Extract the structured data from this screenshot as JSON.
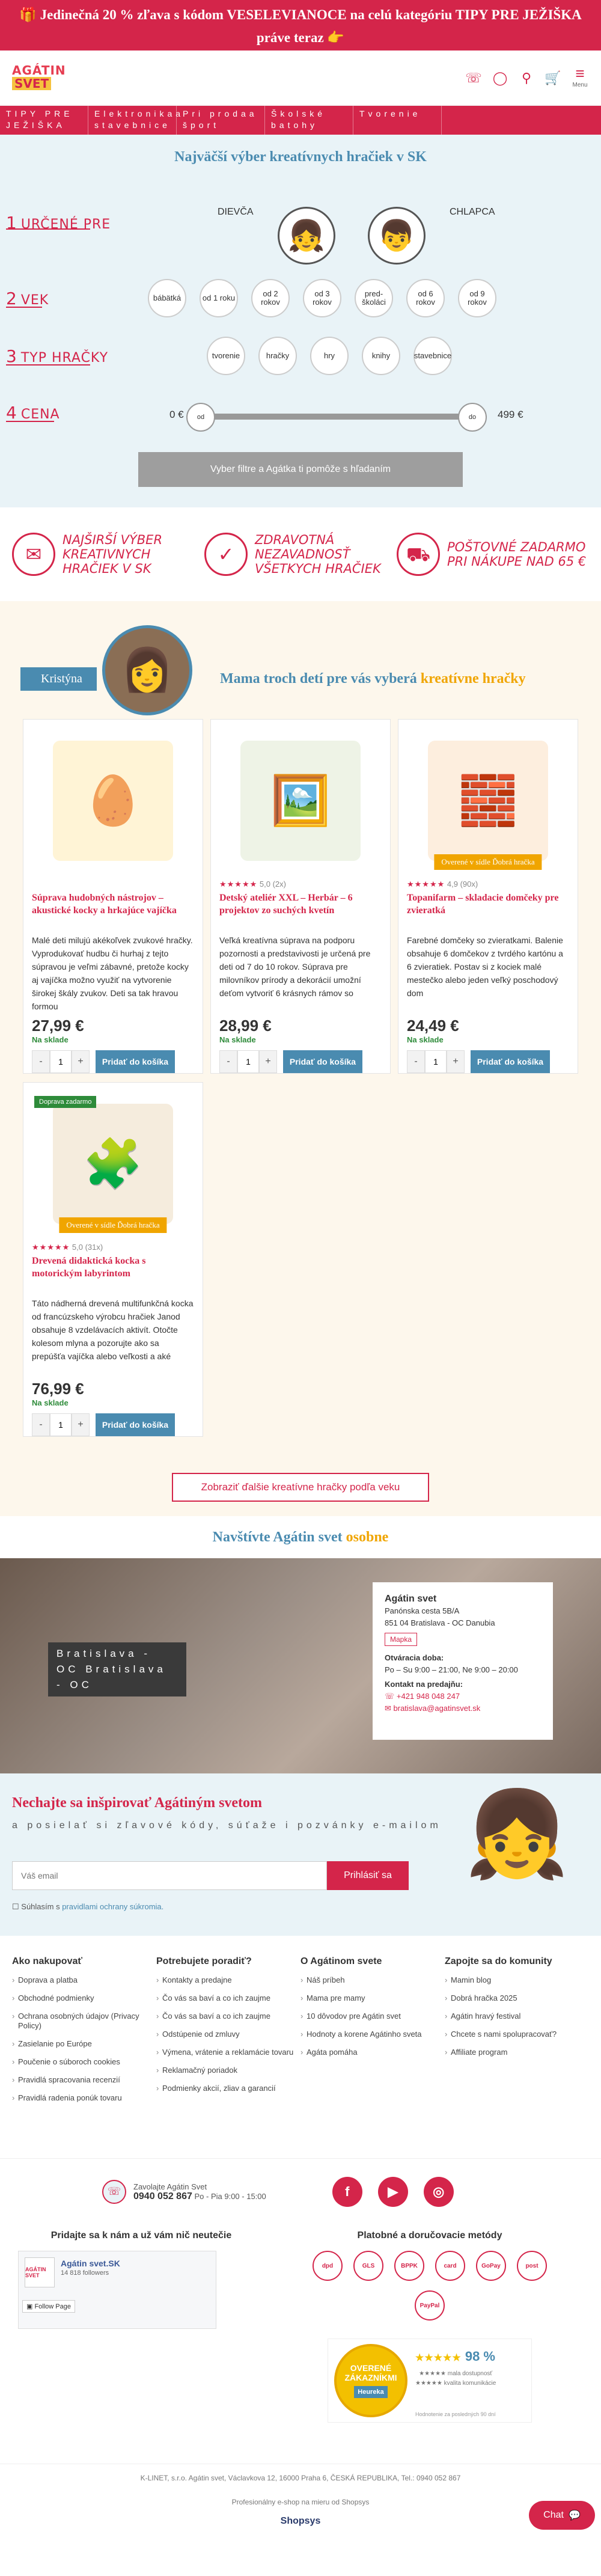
{
  "promo_bar": {
    "icon": "gift-icon",
    "text_line1": "🎁 Jedinečná 20 % zľava s kódom VESELEVIANOCE na celú kategóriu TIPY PRE JEŽIŠKA",
    "text_line2": "práve teraz 👉"
  },
  "header": {
    "logo_line1": "AGÁTIN",
    "logo_line2": "SVET",
    "menu_label": "Menu"
  },
  "category_nav": [
    "TIPY PRE JEŽIŠKA",
    "Elektronikaa stavebnice",
    "Pri prodaa šport",
    "Školské batohy",
    "Tvorenie"
  ],
  "filter": {
    "title": "Najväčší výber kreatívnych hračiek v SK",
    "step1": {
      "num": "1",
      "label": "URČENÉ PRE"
    },
    "girl_label": "DIEVČA",
    "boy_label": "CHLAPCA",
    "step2": {
      "num": "2",
      "label": "VEK"
    },
    "ages": [
      "bábätká",
      "od 1 roku",
      "od 2 rokov",
      "od 3 rokov",
      "pred-školáci",
      "od 6 rokov",
      "od 9 rokov"
    ],
    "step3": {
      "num": "3",
      "label": "TYP HRAČKY"
    },
    "types": [
      "tvorenie",
      "hračky",
      "hry",
      "knihy",
      "stavebnice"
    ],
    "step4": {
      "num": "4",
      "label": "CENA"
    },
    "price_min_label": "0 €",
    "price_max_label": "499 €",
    "knob_left": "od",
    "knob_right": "do",
    "help_button": "Vyber filtre a Agátka ti pomôže s hľadaním"
  },
  "usps": [
    {
      "icon": "gift-box-icon",
      "text": "NAJŠIRŠÍ VÝBER KREATIVNYCH HRAČIEK V SK"
    },
    {
      "icon": "shield-check-icon",
      "text": "ZDRAVOTNÁ NEZAVADNOSŤ VŠETKYCH HRAČIEK"
    },
    {
      "icon": "delivery-truck-icon",
      "text": "POŠTOVNÉ ZADARMO PRI NÁKUPE NAD 65 €"
    }
  ],
  "mama_picks": {
    "name": "Kristýna",
    "title_main": "Mama troch detí pre vás vyberá ",
    "title_accent": "kreatívne hračky",
    "more_button": "Zobraziť ďalšie kreatívne hračky podľa veku"
  },
  "products": [
    {
      "emoji": "🥚",
      "img_color": "#fff4d6",
      "badge": "",
      "delivery_badge": "",
      "stars": "",
      "rating": "",
      "title": "Súprava hudobných nástrojov – akustické kocky a hrkajúce vajíčka",
      "desc": "Malé deti milujú akékoľvek zvukové hračky. Vyprodukovať hudbu či hurhaj z tejto súpravou je veľmi zábavné, pretože kocky aj vajíčka možno využiť na vytvorenie širokej škály zvukov. Deti sa tak hravou formou",
      "price": "27,99 €",
      "stock": "Na sklade",
      "qty": "1",
      "cart_label": "Pridať do košíka"
    },
    {
      "emoji": "🖼️",
      "img_color": "#eef3e6",
      "badge": "",
      "delivery_badge": "",
      "stars": "★★★★★",
      "rating": "5,0 (2x)",
      "title": "Detský ateliér XXL – Herbár – 6 projektov zo suchých kvetín",
      "desc": "Veľká kreatívna súprava na podporu pozornosti a predstavivosti je určená pre deti od 7 do 10 rokov. Súprava pre milovníkov prírody a dekorácií umožní deťom vytvoriť 6 krásnych rámov so",
      "price": "28,99 €",
      "stock": "Na sklade",
      "qty": "1",
      "cart_label": "Pridať do košíka"
    },
    {
      "emoji": "🧱",
      "img_color": "#fdeede",
      "badge": "Overené v sídle Ďobrá hračka",
      "delivery_badge": "",
      "stars": "★★★★★",
      "rating": "4,9 (90x)",
      "title": "Topanifarm – skladacie domčeky pre zvieratká",
      "desc": "Farebné domčeky so zvieratkami. Balenie obsahuje 6 domčekov z tvrdého kartónu a 6 zvieratiek. Postav si z kociek malé mestečko alebo jeden veľký poschodový dom",
      "price": "24,49 €",
      "stock": "Na sklade",
      "qty": "1",
      "cart_label": "Pridať do košíka"
    },
    {
      "emoji": "🧩",
      "img_color": "#f5ecdd",
      "badge": "Overené v sídle Ďobrá hračka",
      "delivery_badge": "Doprava zadarmo",
      "stars": "★★★★★",
      "rating": "5,0 (31x)",
      "title": "Drevená didaktická kocka s motorickým labyrintom",
      "desc": "Táto nádherná drevená multifunkčná kocka od francúzskeho výrobcu hračiek Janod obsahuje 8 vzdelávacích aktivít. Otočte kolesom mlyna a pozorujte ako sa prepúšťa vajíčka alebo veľkosti a aké",
      "price": "76,99 €",
      "stock": "Na sklade",
      "qty": "1",
      "cart_label": "Pridať do košíka"
    }
  ],
  "store": {
    "section_title_main": "Navštívte Agátin svet ",
    "section_title_accent": "osobne",
    "sign": "Bratislava - OC Bratislava - OC",
    "card_title": "Agátin svet",
    "address1": "Panónska cesta 5B/A",
    "address2": "851 04 Bratislava - OC Danubia",
    "map_button": "Mapka",
    "hours_head": "Otváracia doba:",
    "hours": "Po – Su 9:00 – 21:00, Ne 9:00 – 20:00",
    "phone_head": "Kontakt na predajňu:",
    "phone": "+421 948 048 247",
    "email": "bratislava@agatinsvet.sk"
  },
  "newsletter": {
    "title": "Nechajte sa inšpirovať Agátiným svetom",
    "text": "a posielať si zľavové kódy, súťaže i pozvánky e-mailom",
    "placeholder": "Váš email",
    "button": "Prihlásiť sa",
    "consent_prefix": "Súhlasím s ",
    "consent_link": "pravidlami ochrany súkromia."
  },
  "footer": {
    "cols": [
      {
        "title": "Ako nakupovať",
        "links": [
          "Doprava a platba",
          "Obchodné podmienky",
          "Ochrana osobných údajov (Privacy Policy)",
          "Zasielanie po Európe",
          "Poučenie o súboroch cookies",
          "Pravidlá spracovania recenzií",
          "Pravidlá radenia pon­úk tovaru"
        ]
      },
      {
        "title": "Potrebujete poradiť?",
        "links": [
          "Kontakty a predajne",
          "Čo vás sa baví a co ich zaujme",
          "Čo vás sa baví a co ich zaujme",
          "Odstúpenie od zmluvy",
          "Výmena, vrátenie a reklamácie tovaru",
          "Reklamačný poriadok",
          "Podmienky akcií, zliav a garancií"
        ]
      },
      {
        "title": "O Agátinom svete",
        "links": [
          "Náš príbeh",
          "Mama pre mamy",
          "10 dôvodov pre Agátin svet",
          "Hodnoty a korene Agátinho sveta",
          "Agáta pomáha"
        ]
      },
      {
        "title": "Zapojte sa do komunity",
        "links": [
          "Mamin blog",
          "Dobrá hračka 2025",
          "Agátin hravý festival",
          "Chcete s nami spolupracovať?",
          "Affiliate program"
        ]
      }
    ],
    "phone_label": "Zavolajte Agátin Svet",
    "phone_number": "0940 052 867",
    "phone_hours": "Po - Pia 9:00 - 15:00",
    "social_label1": "f",
    "social_label2": "▶",
    "social_label3": "◎",
    "fb_title": "Pridajte sa k nám a už vám nič neutečie",
    "fb_name": "Agátin svet.SK",
    "fb_followers": "14 818 followers",
    "fb_follow": "Follow Page",
    "fb_logo": "AGÁTIN SVET",
    "pay_title": "Platobné a doručovacie metódy",
    "pay_methods": [
      "dpd",
      "GLS",
      "BPPK",
      "card",
      "GoPay",
      "post",
      "PayPal"
    ],
    "heureka_badge_top": "OVERENÉ ZÁKAZNÍKMI",
    "heureka_badge_brand": "Heureka",
    "heureka_score": "98 %",
    "heureka_stars": "★★★★★",
    "heureka_line1": "★★★★★ mala dostupnosť",
    "heureka_line2": "★★★★★ kvalita komunikácie",
    "heureka_note": "Hodnotenie za posledných 90 dní",
    "legal1": "K-LINET, s.r.o. Agátin svet, Václavkova 12, 16000 Praha 6, ČESKÁ REPUBLIKA, Tel.: 0940 052 867",
    "legal2": "Profesionálny e-shop na mieru od Shopsys",
    "shopsys": "Shopsys",
    "chat": "Chat"
  },
  "colors": {
    "brand_red": "#d4254a",
    "accent_blue": "#4a8bb0",
    "accent_orange": "#f0a500",
    "stock_green": "#2e8b3a"
  }
}
